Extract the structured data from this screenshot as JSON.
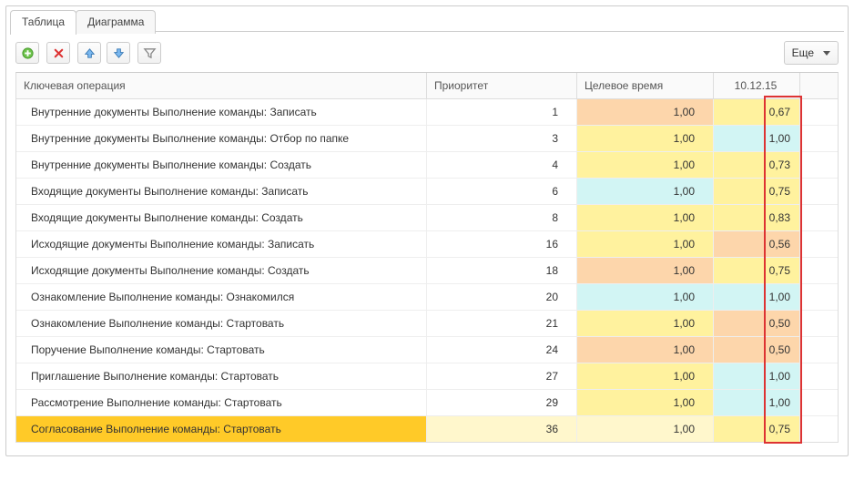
{
  "tabs": {
    "table": "Таблица",
    "chart": "Диаграмма"
  },
  "toolbar": {
    "more": "Еще"
  },
  "headers": {
    "operation": "Ключевая операция",
    "priority": "Приоритет",
    "target": "Целевое время",
    "date": "10.12.15"
  },
  "rows": [
    {
      "op": "Внутренние документы Выполнение команды: Записать",
      "prio": "1",
      "targ": "1,00",
      "val": "0,67",
      "cellbg": "or",
      "valbg": "ye"
    },
    {
      "op": "Внутренние документы Выполнение команды: Отбор по папке",
      "prio": "3",
      "targ": "1,00",
      "val": "1,00",
      "cellbg": "ye",
      "valbg": "cy"
    },
    {
      "op": "Внутренние документы Выполнение команды: Создать",
      "prio": "4",
      "targ": "1,00",
      "val": "0,73",
      "cellbg": "ye",
      "valbg": "ye"
    },
    {
      "op": "Входящие документы Выполнение команды: Записать",
      "prio": "6",
      "targ": "1,00",
      "val": "0,75",
      "cellbg": "cy",
      "valbg": "ye"
    },
    {
      "op": "Входящие документы Выполнение команды: Создать",
      "prio": "8",
      "targ": "1,00",
      "val": "0,83",
      "cellbg": "ye",
      "valbg": "ye"
    },
    {
      "op": "Исходящие документы Выполнение команды: Записать",
      "prio": "16",
      "targ": "1,00",
      "val": "0,56",
      "cellbg": "ye",
      "valbg": "or"
    },
    {
      "op": "Исходящие документы Выполнение команды: Создать",
      "prio": "18",
      "targ": "1,00",
      "val": "0,75",
      "cellbg": "or",
      "valbg": "ye"
    },
    {
      "op": "Ознакомление Выполнение команды: Ознакомился",
      "prio": "20",
      "targ": "1,00",
      "val": "1,00",
      "cellbg": "cy",
      "valbg": "cy"
    },
    {
      "op": "Ознакомление Выполнение команды: Стартовать",
      "prio": "21",
      "targ": "1,00",
      "val": "0,50",
      "cellbg": "ye",
      "valbg": "or"
    },
    {
      "op": "Поручение Выполнение команды: Стартовать",
      "prio": "24",
      "targ": "1,00",
      "val": "0,50",
      "cellbg": "or",
      "valbg": "or"
    },
    {
      "op": "Приглашение Выполнение команды: Стартовать",
      "prio": "27",
      "targ": "1,00",
      "val": "1,00",
      "cellbg": "ye",
      "valbg": "cy"
    },
    {
      "op": "Рассмотрение Выполнение команды: Стартовать",
      "prio": "29",
      "targ": "1,00",
      "val": "1,00",
      "cellbg": "ye",
      "valbg": "cy"
    },
    {
      "op": "Согласование Выполнение команды: Стартовать",
      "prio": "36",
      "targ": "1,00",
      "val": "0,75",
      "cellbg": "ye",
      "valbg": "ye",
      "sel": true
    }
  ]
}
